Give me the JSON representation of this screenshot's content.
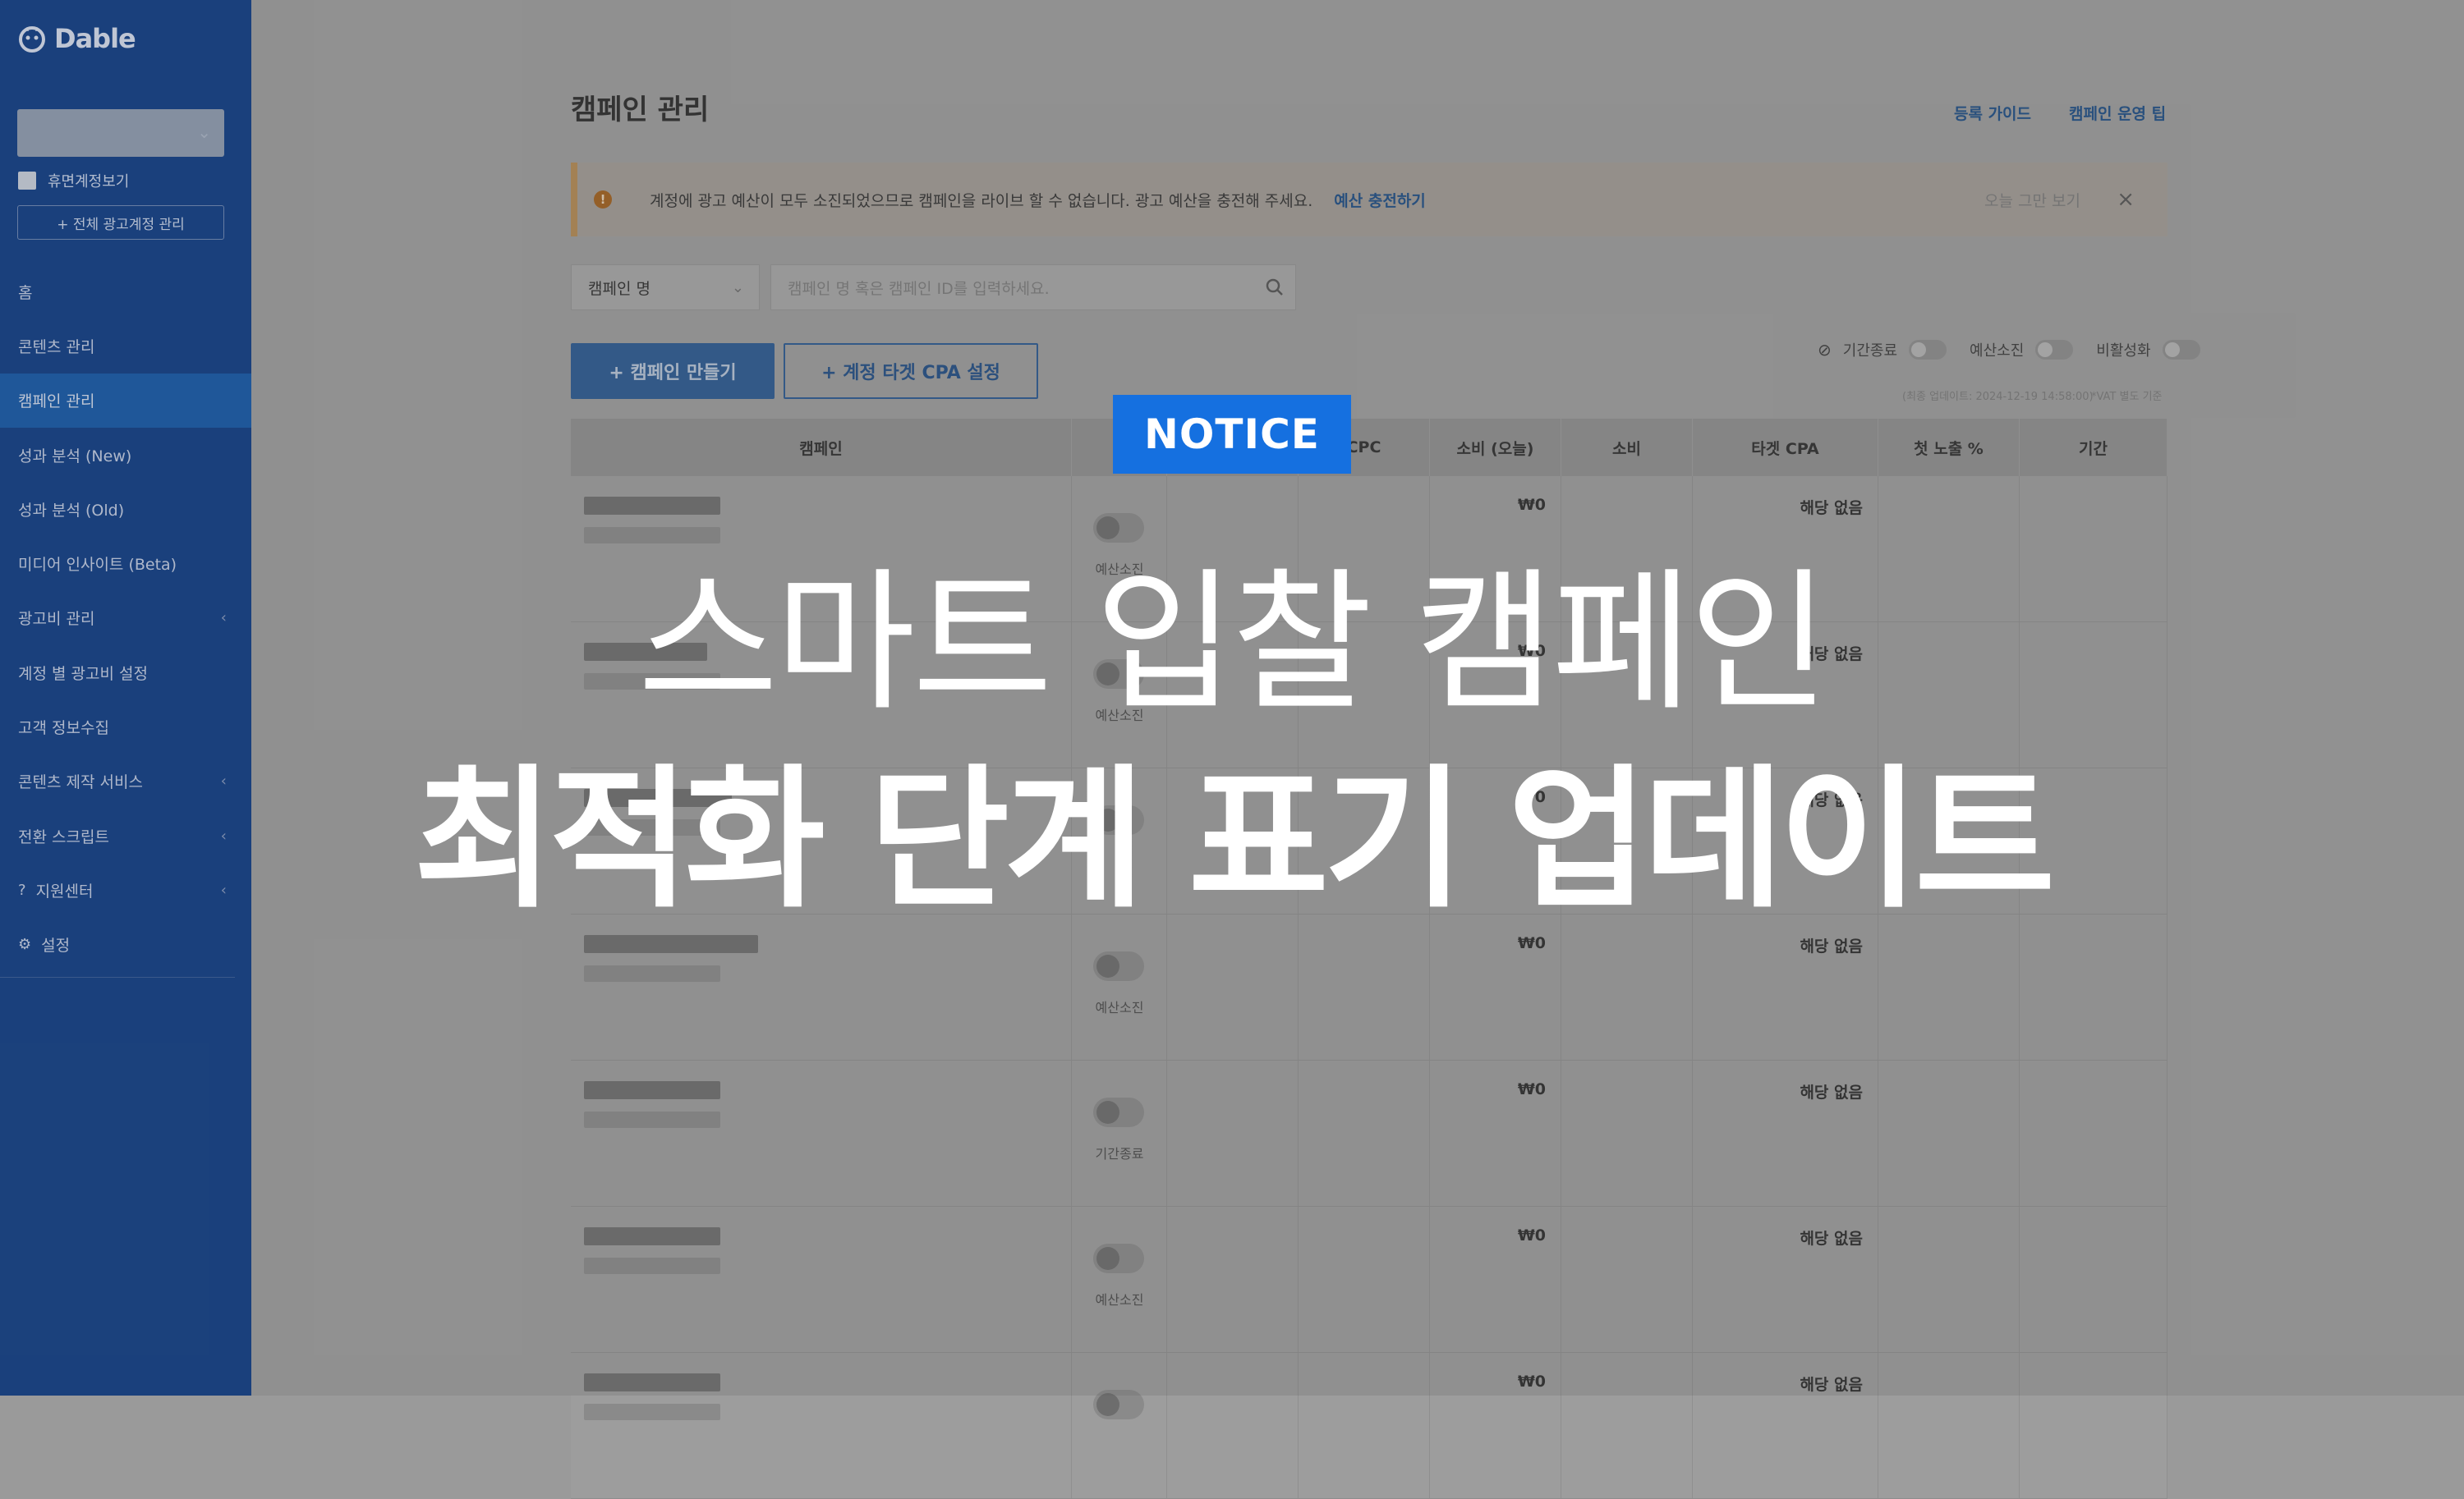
{
  "brand": {
    "logo_text": "Dable"
  },
  "sidebar": {
    "dormant_label": "휴면계정보기",
    "all_accounts_label": "+ 전체 광고계정 관리",
    "items": [
      {
        "label": "홈"
      },
      {
        "label": "콘텐츠 관리"
      },
      {
        "label": "캠페인 관리"
      },
      {
        "label": "성과 분석 (New)"
      },
      {
        "label": "성과 분석 (Old)"
      },
      {
        "label": "미디어 인사이트 (Beta)"
      },
      {
        "label": "광고비 관리"
      },
      {
        "label": "계정 별 광고비 설정"
      },
      {
        "label": "고객 정보수집"
      },
      {
        "label": "콘텐츠 제작 서비스"
      },
      {
        "label": "전환 스크립트"
      },
      {
        "label": "지원센터"
      },
      {
        "label": "설정"
      }
    ]
  },
  "header": {
    "title": "캠페인 관리",
    "links": [
      "등록 가이드",
      "캠페인 운영 팁"
    ]
  },
  "alert": {
    "message": "계정에 광고 예산이 모두 소진되었으므로 캠페인을 라이브 할 수 없습니다. 광고 예산을 충전해 주세요.",
    "action": "예산 충전하기",
    "hide_today": "오늘 그만 보기",
    "close": "×"
  },
  "filter": {
    "select_value": "캠페인 명",
    "search_placeholder": "캠페인 명 혹은 캠페인 ID를 입력하세요."
  },
  "actions": {
    "create": "+ 캠페인 만들기",
    "cpa": "+ 계정 타겟 CPA 설정"
  },
  "view_toggles": [
    "기간종료",
    "예산소진",
    "비활성화"
  ],
  "last_update": "(최종 업데이트: 2024-12-19 14:58:00)",
  "vat_note": "*VAT 별도 기준",
  "table": {
    "columns": [
      "캠페인",
      "",
      "",
      "CPC",
      "소비 (오늘)",
      "소비",
      "타겟 CPA",
      "첫 노출 %",
      "기간"
    ],
    "rows": [
      {
        "status": "예산소진",
        "spend_today": "₩0",
        "target_cpa": "해당 없음"
      },
      {
        "status": "예산소진",
        "spend_today": "₩0",
        "target_cpa": "해당 없음"
      },
      {
        "status": "",
        "spend_today": "₩0",
        "target_cpa": "해당 없음"
      },
      {
        "status": "예산소진",
        "spend_today": "₩0",
        "target_cpa": "해당 없음"
      },
      {
        "status": "기간종료",
        "spend_today": "₩0",
        "target_cpa": "해당 없음"
      },
      {
        "status": "예산소진",
        "spend_today": "₩0",
        "target_cpa": "해당 없음"
      },
      {
        "status": "",
        "spend_today": "₩0",
        "target_cpa": "해당 없음"
      }
    ]
  },
  "overlay": {
    "badge": "NOTICE",
    "headline_line1": "스마트 입찰 캠페인",
    "headline_line2": "최적화 단계 표기 업데이트"
  },
  "colors": {
    "sidebar": "#0d3b84",
    "accent": "#1570e0",
    "overlay_text": "#ffffff"
  }
}
